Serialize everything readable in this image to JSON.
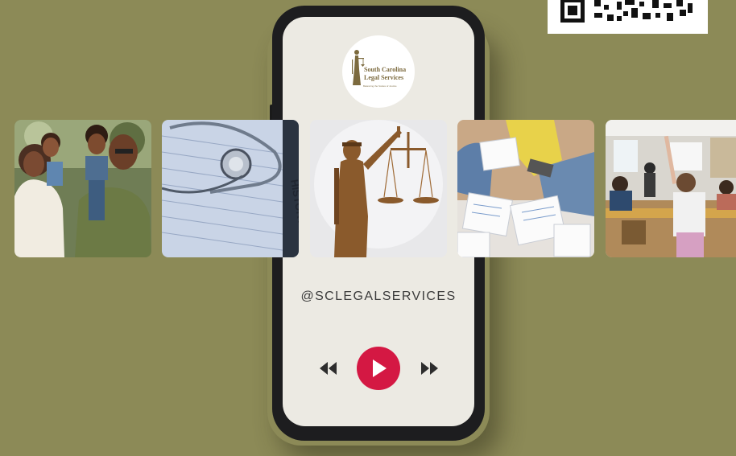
{
  "brand": {
    "line1": "South Carolina",
    "line2": "Legal Services",
    "tagline": "Balancing the Scales of Justice",
    "color": "#7c6a3e"
  },
  "social": {
    "handle": "@SCLEGALSERVICES"
  },
  "player": {
    "accent_color": "#d41843",
    "controls": [
      "rewind-icon",
      "play-icon",
      "fast-forward-icon"
    ]
  },
  "photos": [
    {
      "subject": "family"
    },
    {
      "subject": "medical-history-form"
    },
    {
      "subject": "lady-justice-statue"
    },
    {
      "subject": "paperwork"
    },
    {
      "subject": "classroom"
    }
  ],
  "form_text": "HISTORY FORM",
  "background_color": "#8c8a57"
}
